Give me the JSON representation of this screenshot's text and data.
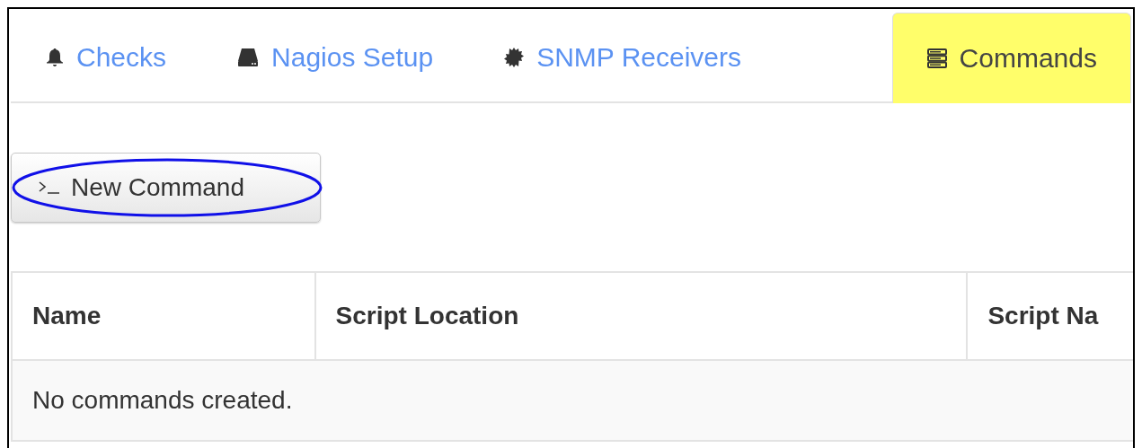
{
  "tabs": [
    {
      "label": "Checks",
      "selected": false
    },
    {
      "label": "Nagios Setup",
      "selected": false
    },
    {
      "label": "SNMP Receivers",
      "selected": false
    },
    {
      "label": "Commands",
      "selected": true
    }
  ],
  "new_button": {
    "label": "New Command",
    "highlighted": true
  },
  "table": {
    "columns": [
      "Name",
      "Script Location",
      "Script Na"
    ],
    "empty_message": "No commands created."
  }
}
